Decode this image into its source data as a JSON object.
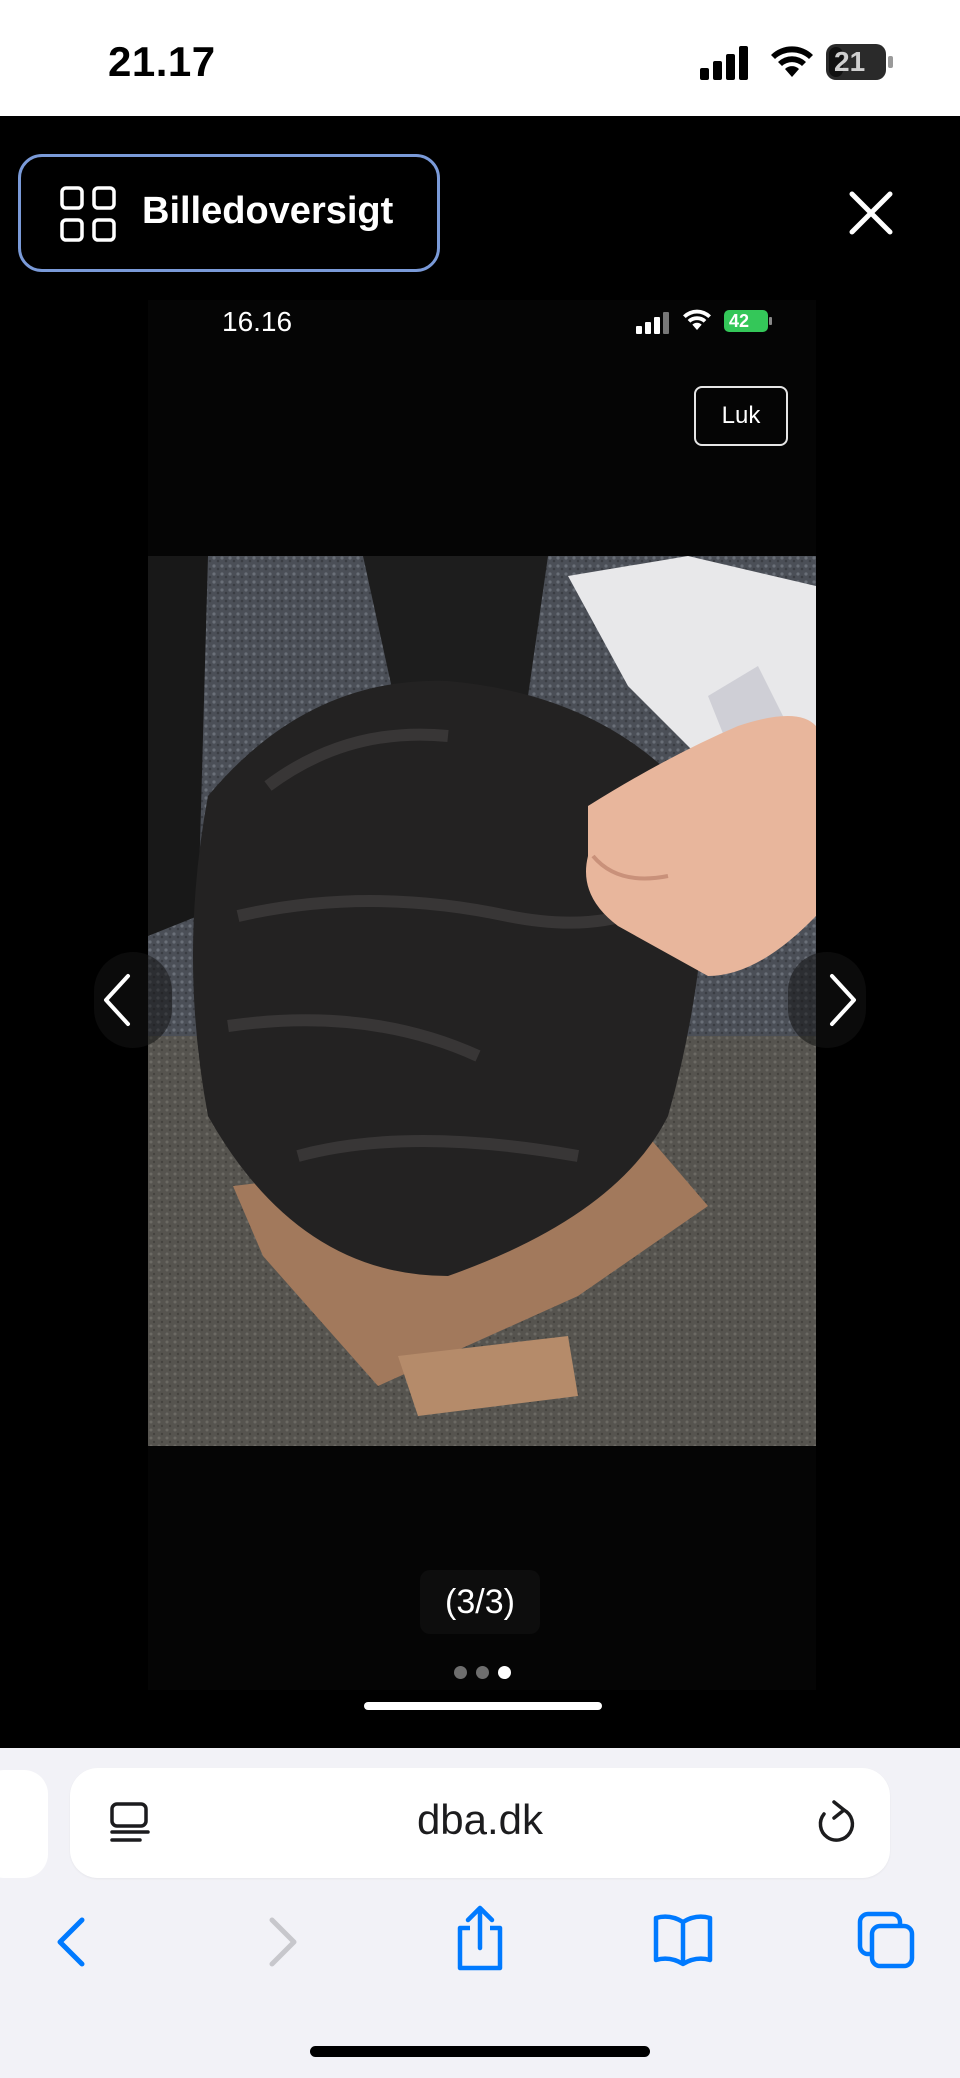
{
  "status_bar": {
    "time": "21.17",
    "battery": "21"
  },
  "viewer": {
    "overview_label": "Billedoversigt",
    "inner_status": {
      "time": "16.16",
      "battery": "42"
    },
    "close_label": "Luk",
    "counter": "(3/3)",
    "dots": {
      "total": 3,
      "active": 3
    }
  },
  "browser": {
    "url": "dba.dk"
  },
  "icons": [
    "grid-icon",
    "close-icon",
    "chevron-left-icon",
    "chevron-right-icon",
    "reader-icon",
    "reload-icon",
    "back-icon",
    "forward-icon",
    "share-icon",
    "bookmarks-icon",
    "tabs-icon"
  ],
  "colors": {
    "accent": "#007aff",
    "focus_ring": "#7a9ad8",
    "battery_green": "#34c759"
  }
}
